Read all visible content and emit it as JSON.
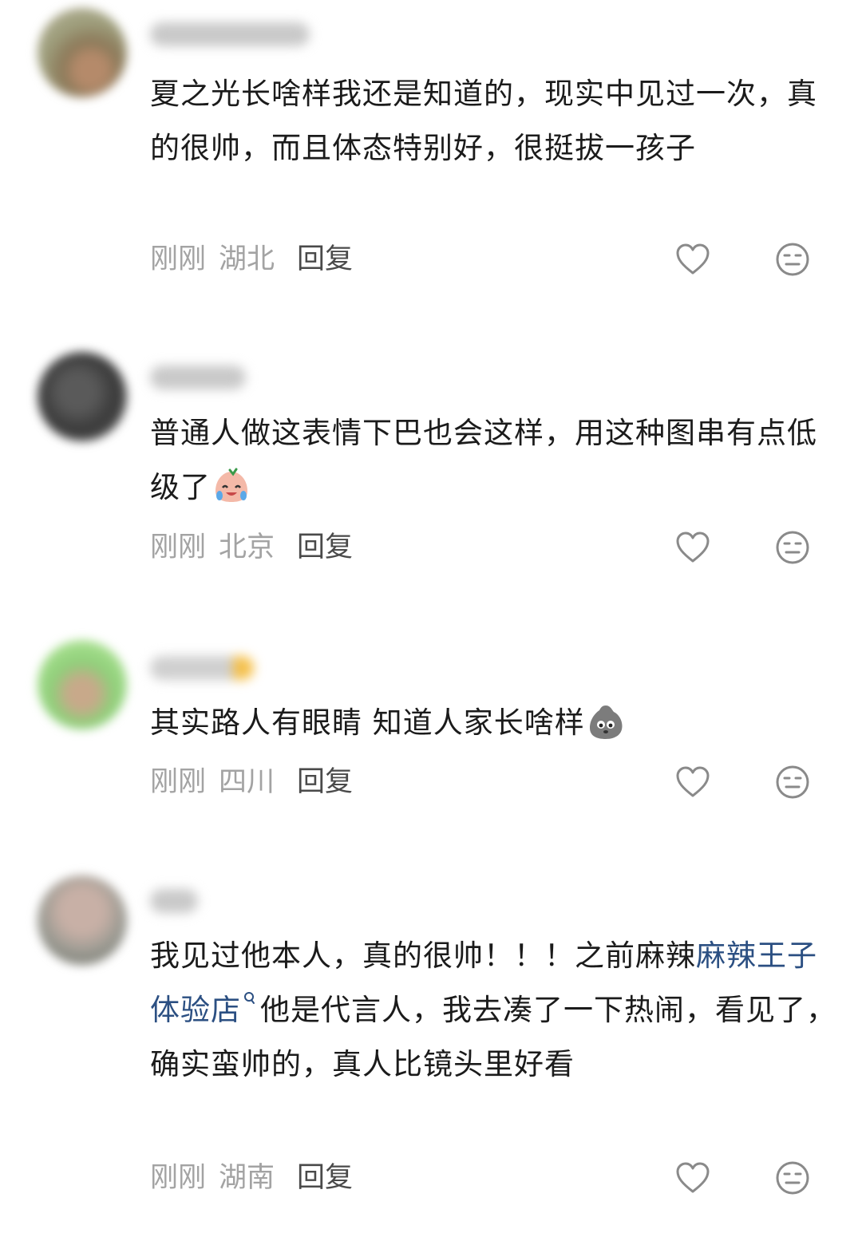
{
  "comments": [
    {
      "text": "夏之光长啥样我还是知道的，现实中见过一次，真的很帅，而且体态特别好，很挺拔一孩子",
      "time": "刚刚",
      "location": "湖北",
      "reply_label": "回复"
    },
    {
      "text": "普通人做这表情下巴也会这样，用这种图串有点低级了",
      "emoji": "laughing-crying-sticker",
      "time": "刚刚",
      "location": "北京",
      "reply_label": "回复"
    },
    {
      "text": "其实路人有眼睛 知道人家长啥样",
      "emoji": "gray-blob-sticker",
      "time": "刚刚",
      "location": "四川",
      "reply_label": "回复"
    },
    {
      "text_before": "我见过他本人，真的很帅！！！之前麻辣",
      "link": "麻辣王子体验店",
      "text_after": "他是代言人，我去凑了一下热闹，看见了，确实蛮帅的，真人比镜头里好看",
      "time": "刚刚",
      "location": "湖南",
      "reply_label": "回复"
    }
  ],
  "icons": {
    "like": "heart-outline-icon",
    "dislike": "neutral-face-icon",
    "search_link": "search-link-icon"
  },
  "colors": {
    "text": "#1b1b1b",
    "meta": "#a3a3a3",
    "reply": "#4a4a4a",
    "link": "#2b4f82",
    "icon": "#8a8a8a"
  }
}
